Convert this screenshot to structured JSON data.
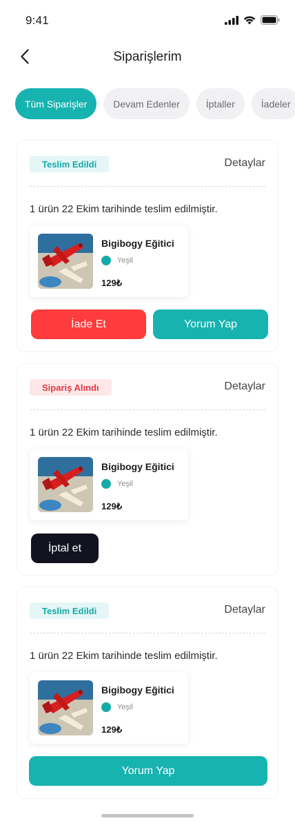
{
  "status_bar": {
    "time": "9:41"
  },
  "header": {
    "title": "Siparişlerim"
  },
  "tabs": [
    {
      "label": "Tüm Siparişler",
      "active": true
    },
    {
      "label": "Devam Edenler",
      "active": false
    },
    {
      "label": "İptaller",
      "active": false
    },
    {
      "label": "İadeler",
      "active": false
    }
  ],
  "orders": [
    {
      "status": "Teslim Edildi",
      "details_label": "Detaylar",
      "message": "1 ürün 22 Ekim tarihinde teslim edilmiştir.",
      "product": {
        "name": "Bigibogy Eğitici",
        "color": "Yeşil",
        "price": "129₺"
      },
      "actions": [
        "İade Et",
        "Yorum Yap"
      ]
    },
    {
      "status": "Sipariş Alındı",
      "details_label": "Detaylar",
      "message": "1 ürün 22 Ekim tarihinde teslim edilmiştir.",
      "product": {
        "name": "Bigibogy Eğitici",
        "color": "Yeşil",
        "price": "129₺"
      },
      "actions": [
        "İptal et"
      ]
    },
    {
      "status": "Teslim Edildi",
      "details_label": "Detaylar",
      "message": "1 ürün 22 Ekim tarihinde teslim edilmiştir.",
      "product": {
        "name": "Bigibogy Eğitici",
        "color": "Yeşil",
        "price": "129₺"
      },
      "actions": [
        "Yorum Yap"
      ]
    }
  ],
  "colors": {
    "accent": "#16b3b0",
    "danger": "#ff3b3b",
    "dark": "#12131f",
    "delivered_badge_bg": "#e4f6f6",
    "received_badge_bg": "#fde7e8"
  },
  "icons": {
    "back": "chevron-left-icon",
    "signal": "cellular-signal-icon",
    "wifi": "wifi-icon",
    "battery": "battery-icon"
  }
}
